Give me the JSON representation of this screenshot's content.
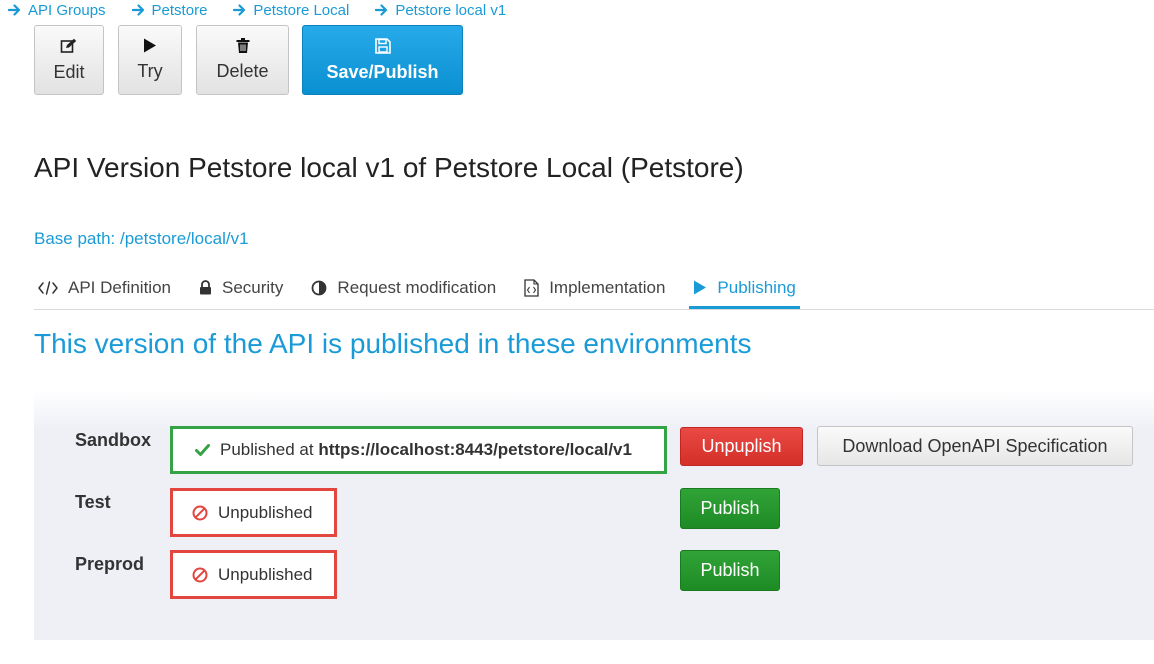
{
  "breadcrumb": [
    {
      "label": "API Groups"
    },
    {
      "label": "Petstore"
    },
    {
      "label": "Petstore Local"
    },
    {
      "label": "Petstore local v1"
    }
  ],
  "toolbar": {
    "edit_label": "Edit",
    "try_label": "Try",
    "delete_label": "Delete",
    "save_label": "Save/Publish"
  },
  "page": {
    "title": "API Version Petstore local v1 of Petstore Local (Petstore)",
    "base_path": "Base path: /petstore/local/v1"
  },
  "tabs": [
    {
      "label": "API Definition",
      "icon": "code-icon"
    },
    {
      "label": "Security",
      "icon": "lock-icon"
    },
    {
      "label": "Request modification",
      "icon": "half-circle-icon"
    },
    {
      "label": "Implementation",
      "icon": "code-file-icon"
    },
    {
      "label": "Publishing",
      "icon": "play-icon",
      "active": true
    }
  ],
  "publishing": {
    "section_title": "This version of the API is published in these environments",
    "environments": [
      {
        "name": "Sandbox",
        "status_prefix": "Published at",
        "status_url": "https://localhost:8443/petstore/local/v1",
        "primary_action": "Unpuplish",
        "secondary_action": "Download OpenAPI Specification"
      },
      {
        "name": "Test",
        "status": "Unpublished",
        "primary_action": "Publish"
      },
      {
        "name": "Preprod",
        "status": "Unpublished",
        "primary_action": "Publish"
      }
    ]
  },
  "colors": {
    "accent": "#1a9bd7",
    "success": "#34a346",
    "danger": "#e2463f",
    "publish_button": "#2a9a31"
  }
}
